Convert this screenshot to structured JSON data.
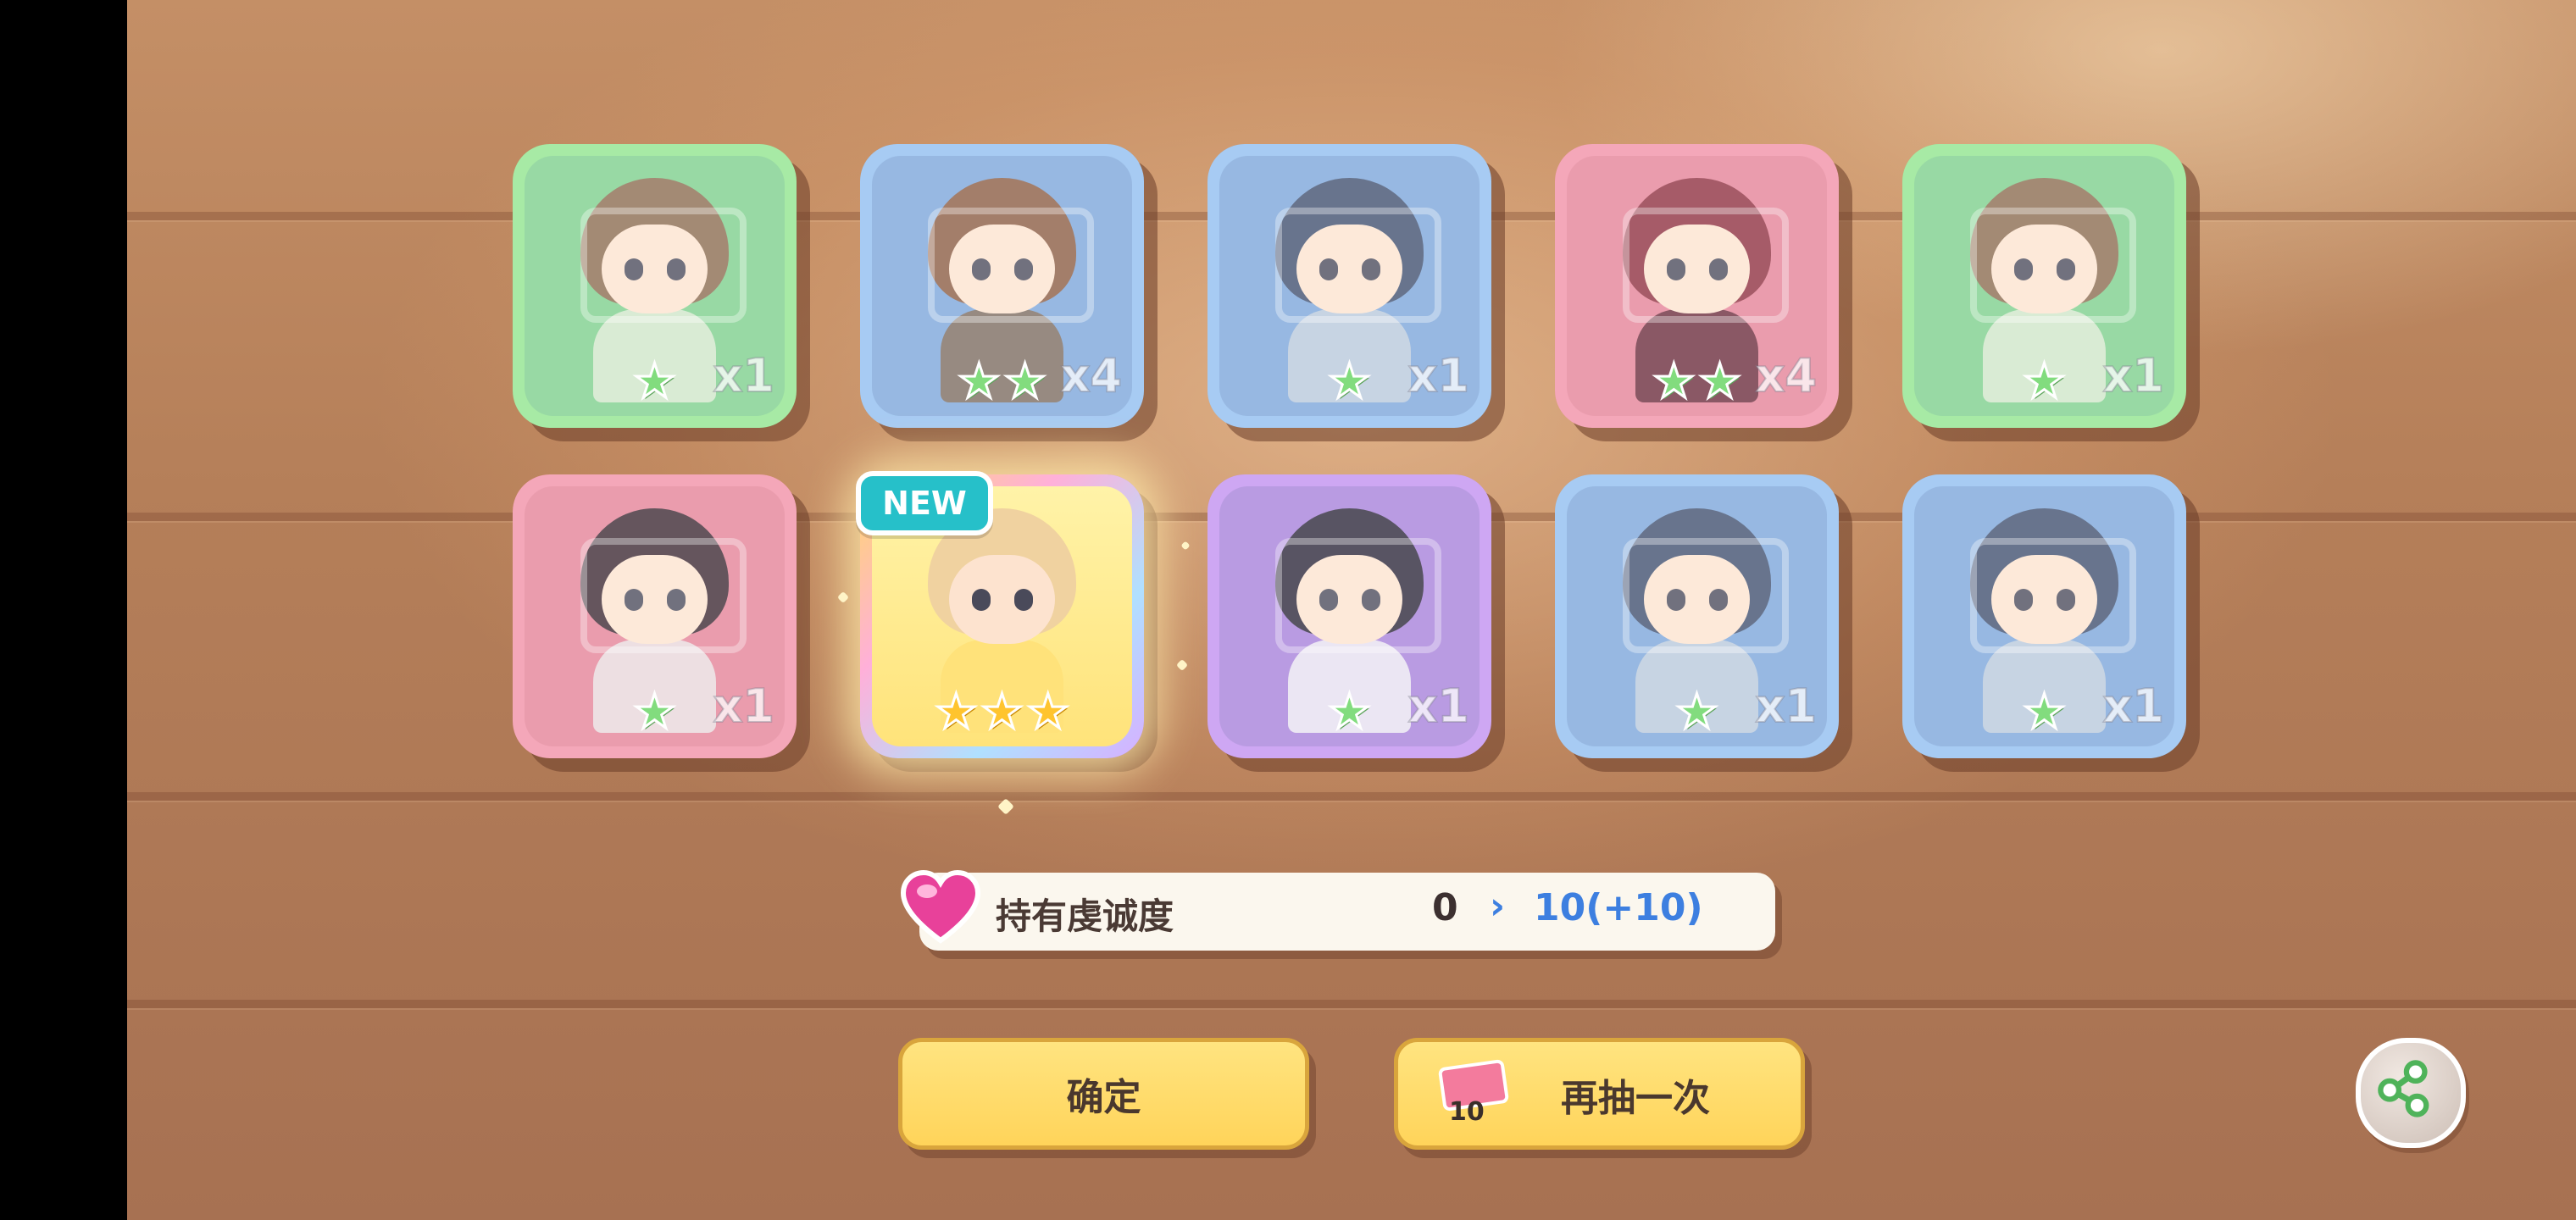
{
  "results": [
    {
      "name": "card-1",
      "color": "green",
      "stars": 1,
      "count": "x1",
      "dimmed": true,
      "hair": "#8a6a4e",
      "outfit": "#cfe6c8"
    },
    {
      "name": "card-2",
      "color": "blue",
      "stars": 2,
      "count": "x4",
      "dimmed": true,
      "hair": "#8a5a40",
      "outfit": "#7a6a5e"
    },
    {
      "name": "card-3",
      "color": "blue",
      "stars": 1,
      "count": "x1",
      "dimmed": true,
      "hair": "#3e4e6e",
      "outfit": "#b8c8dc"
    },
    {
      "name": "card-4",
      "color": "pink",
      "stars": 2,
      "count": "x4",
      "dimmed": true,
      "hair": "#8e2e3e",
      "outfit": "#6a2a3a"
    },
    {
      "name": "card-5",
      "color": "green",
      "stars": 1,
      "count": "x1",
      "dimmed": true,
      "hair": "#8a6a4e",
      "outfit": "#cfe6c8"
    },
    {
      "name": "card-6",
      "color": "pink",
      "stars": 1,
      "count": "x1",
      "dimmed": true,
      "hair": "#3a2630",
      "outfit": "#e8d6da"
    },
    {
      "name": "card-7",
      "color": "rainbow",
      "stars": 3,
      "count": "",
      "dimmed": false,
      "is_new": true,
      "hair": "#f0d2a0",
      "outfit": "#ffe27a"
    },
    {
      "name": "card-8",
      "color": "purple",
      "stars": 1,
      "count": "x1",
      "dimmed": true,
      "hair": "#2a2438",
      "outfit": "#e6dff0"
    },
    {
      "name": "card-9",
      "color": "blue",
      "stars": 1,
      "count": "x1",
      "dimmed": true,
      "hair": "#3e4e6e",
      "outfit": "#b8c8dc"
    },
    {
      "name": "card-10",
      "color": "blue",
      "stars": 1,
      "count": "x1",
      "dimmed": true,
      "hair": "#3e4e6e",
      "outfit": "#b8c8dc"
    }
  ],
  "new_badge": "NEW",
  "devotion": {
    "label": "持有虔诚度",
    "from": "0",
    "arrow": "›",
    "to": "10(+10)"
  },
  "buttons": {
    "confirm": "确定",
    "draw_again": "再抽一次",
    "ticket_count": "10"
  },
  "icons": {
    "heart": "heart-icon",
    "ticket": "ticket-icon",
    "share": "share-icon",
    "star": "star-icon"
  },
  "colors": {
    "star_green": "#5fd25a",
    "star_gold": "#ffc42e",
    "accent_blue": "#3d7fe0",
    "button_yellow": "#ffd45a"
  }
}
